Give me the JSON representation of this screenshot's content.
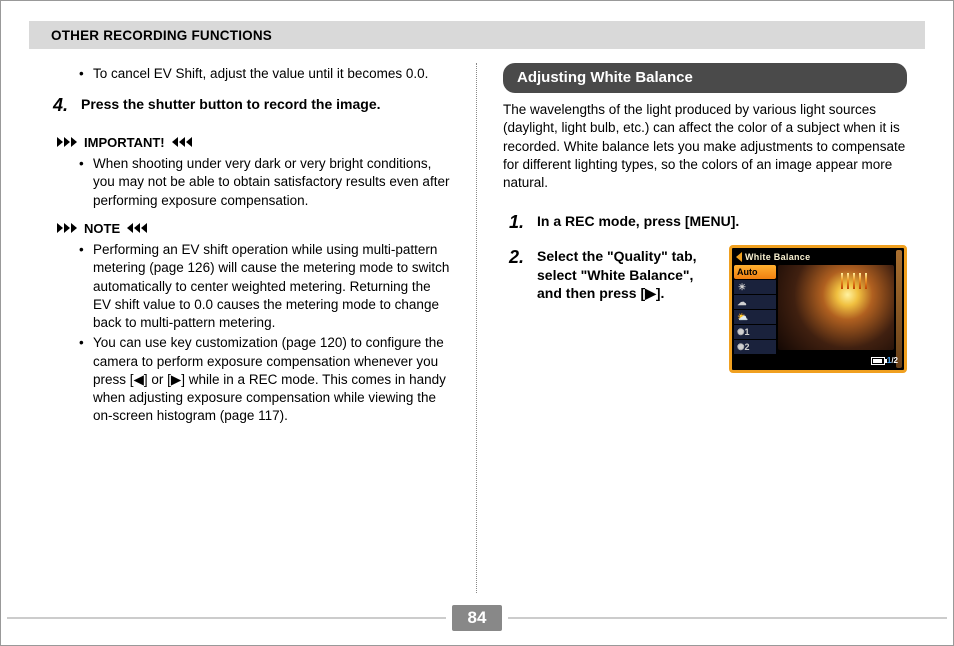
{
  "header": {
    "title": "OTHER RECORDING FUNCTIONS"
  },
  "left": {
    "cancel_bullet": "To cancel EV Shift, adjust the value until it becomes 0.0.",
    "step4_num": "4.",
    "step4_text": "Press the shutter button to record the image.",
    "important_label": "IMPORTANT!",
    "important_bullet": "When shooting under very dark or very bright conditions, you may not be able to obtain satisfactory results even after performing exposure compensation.",
    "note_label": "NOTE",
    "note_bullet1": "Performing an EV shift operation while using multi-pattern metering (page 126) will cause the metering mode to switch automatically to center weighted metering. Returning the EV shift value to 0.0 causes the metering mode to change back to multi-pattern metering.",
    "note_bullet2": "You can use key customization (page 120) to configure the camera to perform exposure compensation whenever you press [◀] or [▶] while in a REC mode. This comes in handy when adjusting exposure compensation while viewing the on-screen histogram (page 117)."
  },
  "right": {
    "heading": "Adjusting White Balance",
    "intro": "The wavelengths of the light produced by various light sources (daylight, light bulb, etc.) can affect the color of a subject when it is recorded. White balance lets you make adjustments to compensate for different lighting types, so the colors of an image appear more natural.",
    "step1_num": "1.",
    "step1_text": "In a REC mode, press [MENU].",
    "step2_num": "2.",
    "step2_text": "Select the \"Quality\" tab, select \"White Balance\", and then press [▶].",
    "screenshot": {
      "title": "White Balance",
      "rows": [
        "Auto",
        "☀",
        "☁",
        "⛅",
        "✺1",
        "✺2"
      ],
      "page_current": "1",
      "page_total": "/2"
    }
  },
  "page_number": "84"
}
